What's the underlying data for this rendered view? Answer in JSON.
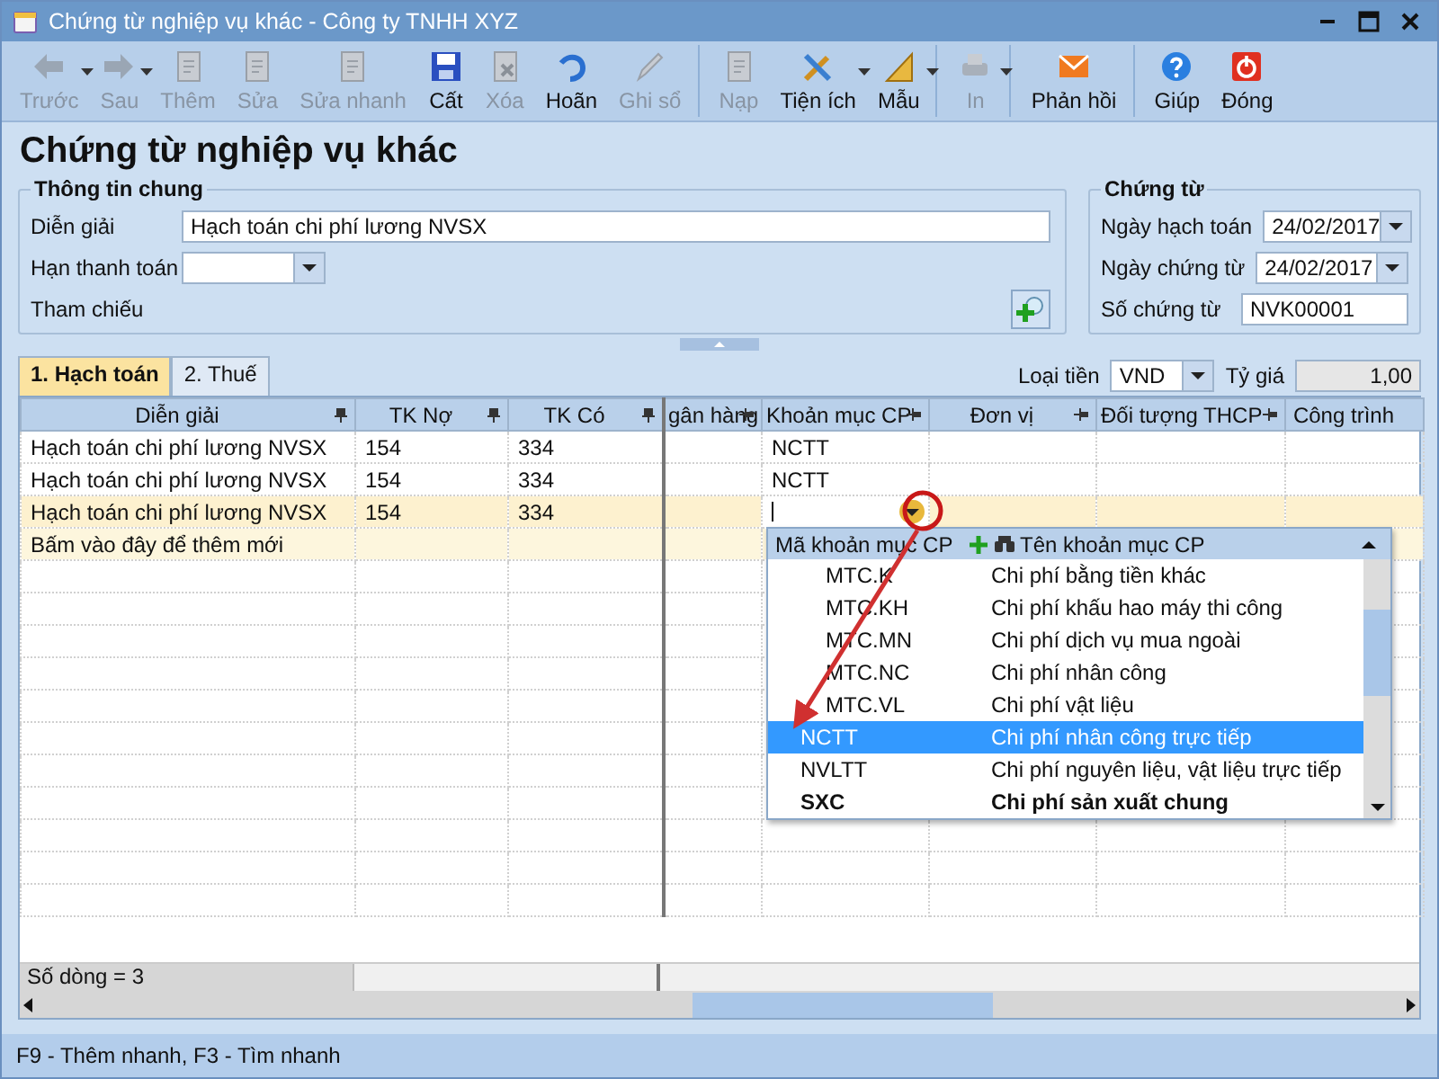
{
  "window": {
    "title": "Chứng từ nghiệp vụ khác - Công ty TNHH XYZ"
  },
  "toolbar": [
    {
      "label": "Trước",
      "disabled": true,
      "dropdown": true,
      "separator_after": false
    },
    {
      "label": "Sau",
      "disabled": true,
      "dropdown": true,
      "separator_after": false
    },
    {
      "label": "Thêm",
      "disabled": true,
      "dropdown": false,
      "separator_after": false
    },
    {
      "label": "Sửa",
      "disabled": true,
      "dropdown": false,
      "separator_after": false
    },
    {
      "label": "Sửa nhanh",
      "disabled": true,
      "dropdown": false,
      "separator_after": false
    },
    {
      "label": "Cất",
      "disabled": false,
      "dropdown": false,
      "separator_after": false
    },
    {
      "label": "Xóa",
      "disabled": true,
      "dropdown": false,
      "separator_after": false
    },
    {
      "label": "Hoãn",
      "disabled": false,
      "dropdown": false,
      "separator_after": false
    },
    {
      "label": "Ghi sổ",
      "disabled": true,
      "dropdown": false,
      "separator_after": true
    },
    {
      "label": "Nạp",
      "disabled": true,
      "dropdown": false,
      "separator_after": false
    },
    {
      "label": "Tiện ích",
      "disabled": false,
      "dropdown": true,
      "separator_after": false
    },
    {
      "label": "Mẫu",
      "disabled": false,
      "dropdown": true,
      "separator_after": true
    },
    {
      "label": "In",
      "disabled": true,
      "dropdown": true,
      "separator_after": true
    },
    {
      "label": "Phản hồi",
      "disabled": false,
      "dropdown": false,
      "separator_after": true
    },
    {
      "label": "Giúp",
      "disabled": false,
      "dropdown": false,
      "separator_after": false
    },
    {
      "label": "Đóng",
      "disabled": false,
      "dropdown": false,
      "separator_after": false
    }
  ],
  "heading": "Chứng từ nghiệp vụ khác",
  "general": {
    "title": "Thông tin chung",
    "fields": [
      {
        "label": "Diễn giải",
        "kind": "text",
        "value": "Hạch toán chi phí lương NVSX"
      },
      {
        "label": "Hạn thanh toán",
        "kind": "combo"
      },
      {
        "label": "Tham chiếu",
        "kind": "button"
      }
    ]
  },
  "voucher": {
    "title": "Chứng từ",
    "fields": [
      {
        "label": "Ngày hạch toán",
        "kind": "combo",
        "value": "24/02/2017"
      },
      {
        "label": "Ngày chứng từ",
        "kind": "combo",
        "value": "24/02/2017"
      },
      {
        "label": "Số chứng từ",
        "kind": "text",
        "value": "NVK00001"
      }
    ]
  },
  "tabs": [
    {
      "label": "1. Hạch toán",
      "selected": true
    },
    {
      "label": "2. Thuế",
      "selected": false
    }
  ],
  "currency": {
    "label": "Loại tiền",
    "value": "VND"
  },
  "rate": {
    "label": "Tỷ giá",
    "value": "1,00"
  },
  "grid": {
    "columns": [
      {
        "label": "Diễn giải",
        "kind": "down"
      },
      {
        "label": "TK Nợ",
        "kind": "down"
      },
      {
        "label": "TK Có",
        "kind": "down"
      },
      {
        "label": "gân hàng",
        "kind": "side"
      },
      {
        "label": "Khoản mục CP",
        "kind": "side"
      },
      {
        "label": "Đơn vị",
        "kind": "side"
      },
      {
        "label": "Đối tượng THCP",
        "kind": "side"
      },
      {
        "label": "Công trình",
        "kind": "plain"
      }
    ],
    "rows": [
      {
        "selected": false,
        "cells": [
          "Hạch toán chi phí lương NVSX",
          "154",
          "334",
          "",
          "NCTT",
          "",
          "",
          ""
        ]
      },
      {
        "selected": false,
        "cells": [
          "Hạch toán chi phí lương NVSX",
          "154",
          "334",
          "",
          "NCTT",
          "",
          "",
          ""
        ]
      },
      {
        "selected": true,
        "cells": [
          "Hạch toán chi phí lương NVSX",
          "154",
          "334",
          "",
          "",
          "",
          "",
          ""
        ]
      }
    ],
    "new_row": "Bấm vào đây để thêm mới",
    "footer": "Số dòng = 3"
  },
  "dropdown": {
    "columns": [
      "Mã khoản mục CP",
      "Tên khoản mục CP"
    ],
    "items": [
      {
        "kind": "child",
        "code": "MTC.K",
        "name": "Chi phí bằng tiền khác",
        "selected": false
      },
      {
        "kind": "child",
        "code": "MTC.KH",
        "name": "Chi phí khấu hao máy thi công",
        "selected": false
      },
      {
        "kind": "child",
        "code": "MTC.MN",
        "name": "Chi phí dịch vụ mua ngoài",
        "selected": false
      },
      {
        "kind": "child",
        "code": "MTC.NC",
        "name": "Chi phí nhân công",
        "selected": false
      },
      {
        "kind": "child",
        "code": "MTC.VL",
        "name": "Chi phí vật liệu",
        "selected": false
      },
      {
        "kind": "item",
        "code": "NCTT",
        "name": "Chi phí nhân công trực tiếp",
        "selected": true
      },
      {
        "kind": "item",
        "code": "NVLTT",
        "name": "Chi phí nguyên liệu, vật liệu trực tiếp",
        "selected": false
      },
      {
        "kind": "group",
        "code": "SXC",
        "name": "Chi phí sản xuất chung",
        "selected": false
      }
    ]
  },
  "status_bar": "F9 - Thêm nhanh, F3 - Tìm nhanh"
}
